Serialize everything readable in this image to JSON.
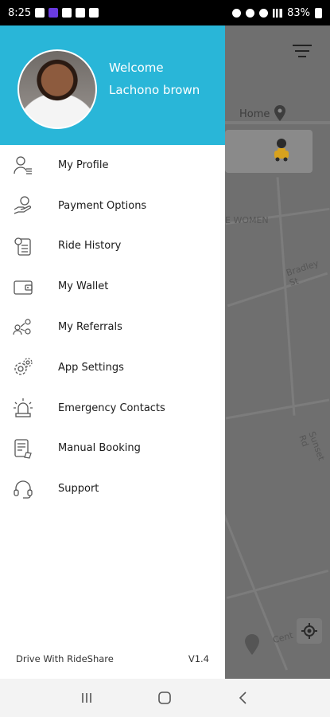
{
  "status_bar": {
    "time": "8:25",
    "battery": "83%"
  },
  "map": {
    "home_label": "Home",
    "labels": [
      "E WOMEN",
      "Bradley St",
      "Sunset Rd",
      "Cent"
    ]
  },
  "drawer": {
    "header": {
      "welcome": "Welcome",
      "username": "Lachono brown"
    },
    "menu": [
      {
        "label": "My Profile",
        "icon": "profile-icon"
      },
      {
        "label": "Payment Options",
        "icon": "payment-icon"
      },
      {
        "label": "Ride History",
        "icon": "history-icon"
      },
      {
        "label": "My Wallet",
        "icon": "wallet-icon"
      },
      {
        "label": "My Referrals",
        "icon": "referrals-icon"
      },
      {
        "label": "App Settings",
        "icon": "settings-icon"
      },
      {
        "label": "Emergency Contacts",
        "icon": "emergency-icon"
      },
      {
        "label": "Manual Booking",
        "icon": "booking-icon"
      },
      {
        "label": "Support",
        "icon": "support-icon"
      }
    ],
    "footer": {
      "link": "Drive With RideShare",
      "version": "V1.4"
    }
  },
  "colors": {
    "header": "#29b6d8",
    "map": "#6f6f6f"
  }
}
